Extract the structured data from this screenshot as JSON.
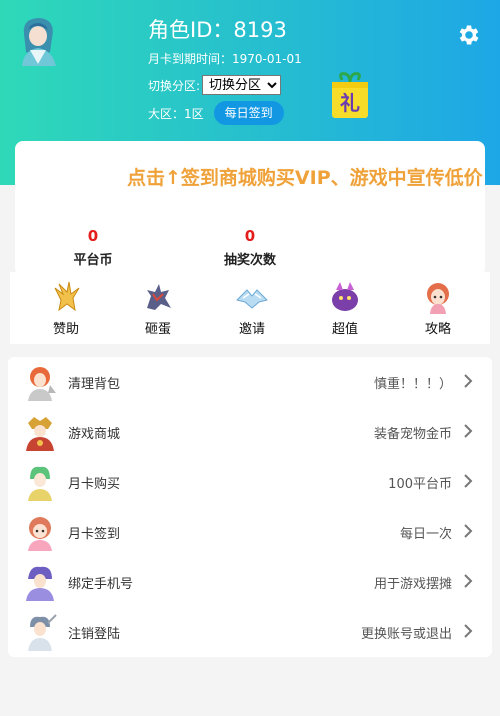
{
  "header": {
    "role_id": "角色ID：8193",
    "month_card_expire": "月卡到期时间：1970-01-01",
    "switch_region_label": "切换分区:",
    "switch_region_selected": "切换分区",
    "big_area_text": "大区：1区",
    "daily_sign_label": "每日签到",
    "gift_char": "礼"
  },
  "announcement": "点击↑签到商城购买VIP、游戏中宣传低价",
  "stats": [
    {
      "value": "0",
      "label": "平台币"
    },
    {
      "value": "0",
      "label": "抽奖次数"
    }
  ],
  "quick_actions": [
    {
      "label": "赞助",
      "icon": "gold-bird-icon"
    },
    {
      "label": "砸蛋",
      "icon": "dragon-icon"
    },
    {
      "label": "邀请",
      "icon": "ice-wings-icon"
    },
    {
      "label": "超值",
      "icon": "purple-creature-icon"
    },
    {
      "label": "攻略",
      "icon": "girl-character-icon"
    }
  ],
  "menu": [
    {
      "label": "清理背包",
      "value": "慎重！！！）"
    },
    {
      "label": "游戏商城",
      "value": "装备宠物金币"
    },
    {
      "label": "月卡购买",
      "value": "100平台币"
    },
    {
      "label": "月卡签到",
      "value": "每日一次"
    },
    {
      "label": "绑定手机号",
      "value": "用于游戏摆摊"
    },
    {
      "label": "注销登陆",
      "value": "更换账号或退出"
    }
  ],
  "colors": {
    "header_start": "#2fd9b8",
    "header_end": "#1ea7e6",
    "sign_button": "#1298e3",
    "stat_value": "#e41c1c",
    "announcement": "#f0a23a"
  }
}
